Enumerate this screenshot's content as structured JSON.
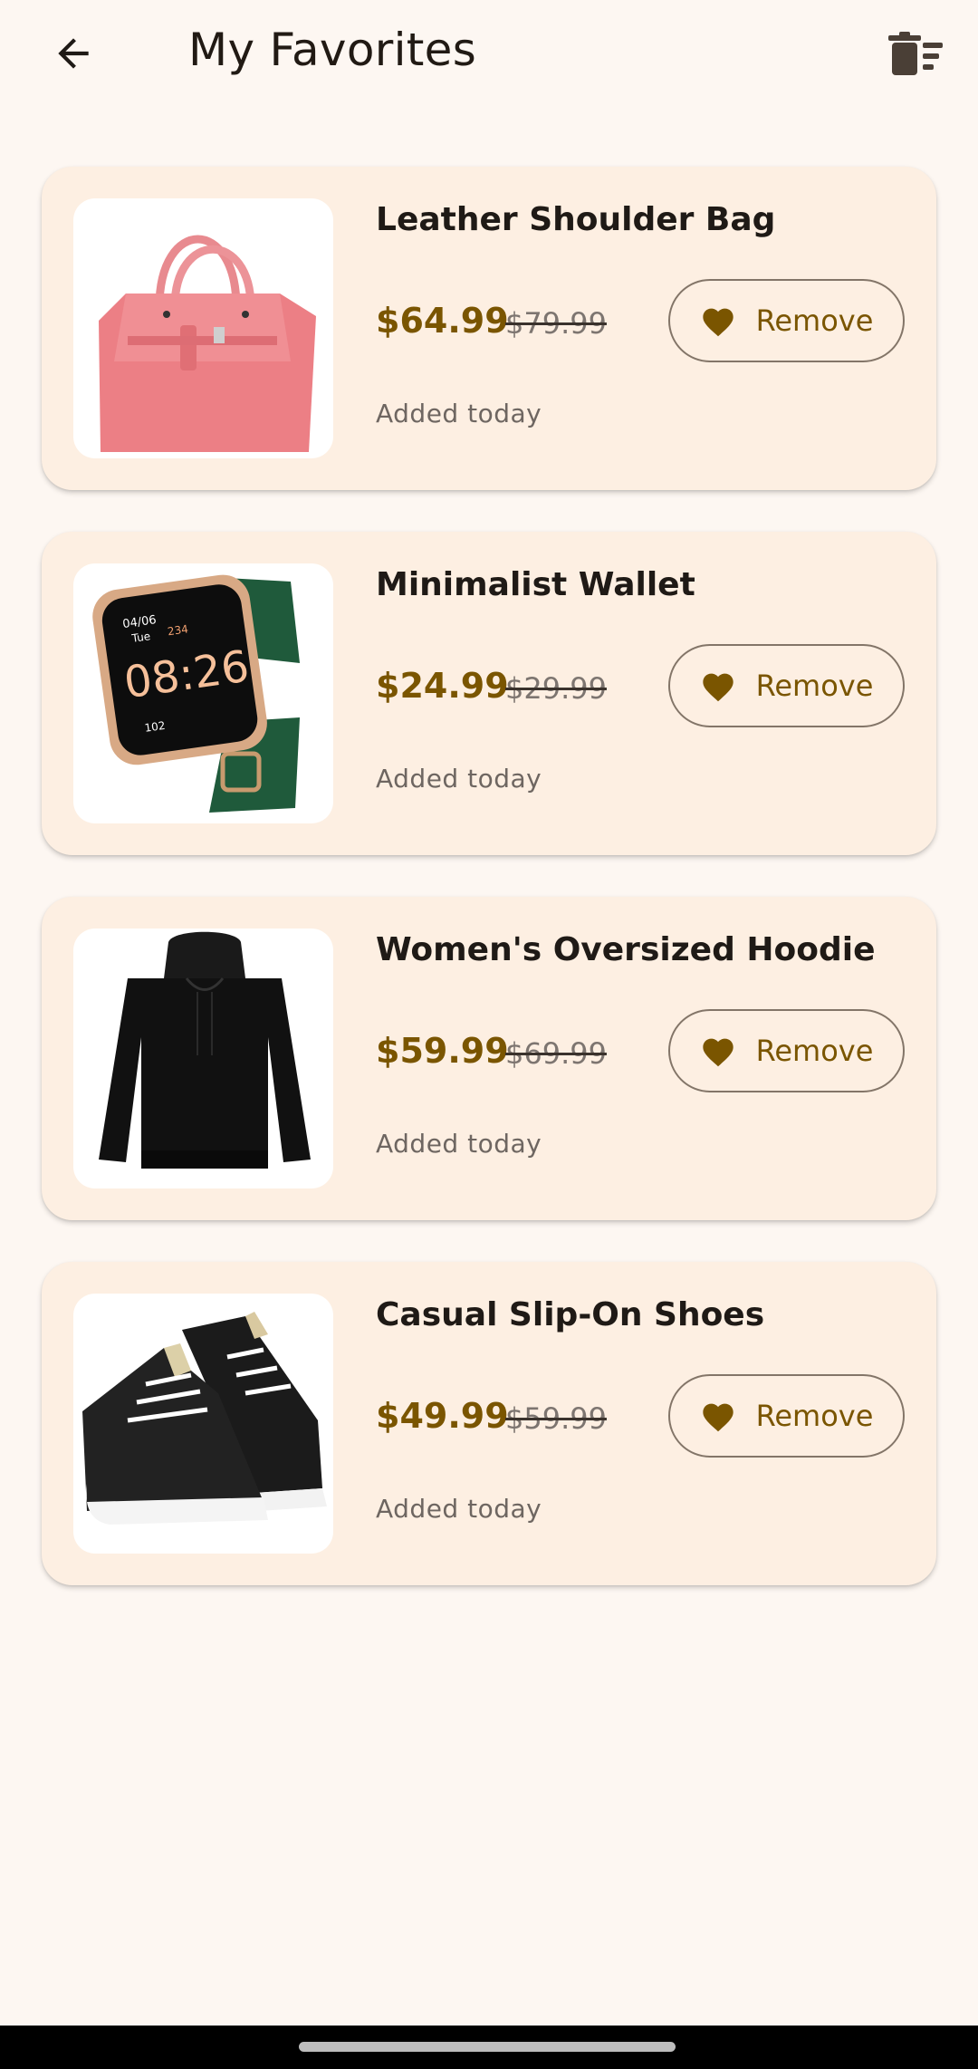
{
  "header": {
    "title": "My Favorites",
    "back_icon": "arrow-left-icon",
    "clear_icon": "delete-sweep-icon"
  },
  "colors": {
    "background": "#FDF7F2",
    "card": "#FDEFE2",
    "accent": "#7A5500"
  },
  "favorites": [
    {
      "name": "Leather Shoulder Bag",
      "price": "$64.99",
      "old_price": "$79.99",
      "added": "Added today",
      "remove_label": "Remove",
      "image": "pink-handbag"
    },
    {
      "name": "Minimalist Wallet",
      "price": "$24.99",
      "old_price": "$29.99",
      "added": "Added today",
      "remove_label": "Remove",
      "image": "green-smartwatch"
    },
    {
      "name": "Women's Oversized Hoodie",
      "price": "$59.99",
      "old_price": "$69.99",
      "added": "Added today",
      "remove_label": "Remove",
      "image": "black-hoodie"
    },
    {
      "name": "Casual Slip-On Shoes",
      "price": "$49.99",
      "old_price": "$59.99",
      "added": "Added today",
      "remove_label": "Remove",
      "image": "black-sneakers"
    }
  ],
  "watch": {
    "date": "04/06",
    "day": "Tue",
    "time": "08:26",
    "steps": "234",
    "heart": "102"
  }
}
